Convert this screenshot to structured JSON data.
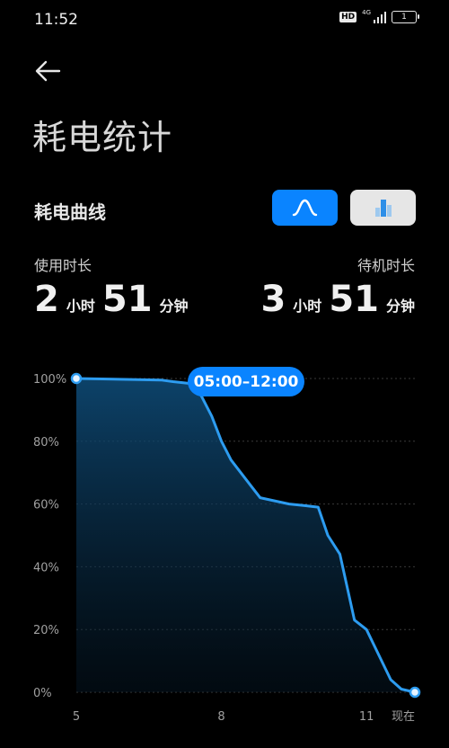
{
  "status_bar": {
    "time": "11:52",
    "hd": "HD",
    "network": "4G",
    "battery_level": "1"
  },
  "header": {
    "back_icon": "arrow-left-icon",
    "title": "耗电统计"
  },
  "section": {
    "title": "耗电曲线",
    "toggle_curve_icon": "curve-icon",
    "toggle_bar_icon": "bar-chart-icon"
  },
  "usage": {
    "screen_on_label": "使用时长",
    "screen_on_hours": "2",
    "screen_on_minutes": "51",
    "standby_label": "待机时长",
    "standby_hours": "3",
    "standby_minutes": "51",
    "hour_unit": "小时",
    "minute_unit": "分钟"
  },
  "colors": {
    "accent": "#0a84ff",
    "line": "#2d9cf0",
    "background": "#000000"
  },
  "chart_data": {
    "type": "area",
    "x": [
      5,
      6.75,
      7.0,
      7.3,
      7.45,
      7.6,
      7.8,
      8.0,
      8.2,
      8.4,
      8.6,
      8.8,
      9.1,
      9.4,
      9.7,
      10.0,
      10.2,
      10.45,
      10.75,
      11.0,
      11.25,
      11.5,
      11.72,
      12.0
    ],
    "y": [
      100,
      99.5,
      99,
      98.5,
      98,
      94,
      88,
      80,
      74,
      70,
      66,
      62,
      61,
      60,
      59.5,
      59,
      50,
      44,
      23,
      20,
      12,
      4,
      1,
      0
    ],
    "x_tick_values": [
      5,
      8,
      11,
      12
    ],
    "x_tick_labels": [
      "5",
      "8",
      "11",
      "现在"
    ],
    "y_tick_labels": [
      "100%",
      "80%",
      "60%",
      "40%",
      "20%",
      "0%"
    ],
    "y_ticks": [
      100,
      80,
      60,
      40,
      20,
      0
    ],
    "xlim": [
      5,
      12
    ],
    "ylim": [
      0,
      100
    ],
    "grid": true,
    "selection_label": "05:00–12:00"
  }
}
